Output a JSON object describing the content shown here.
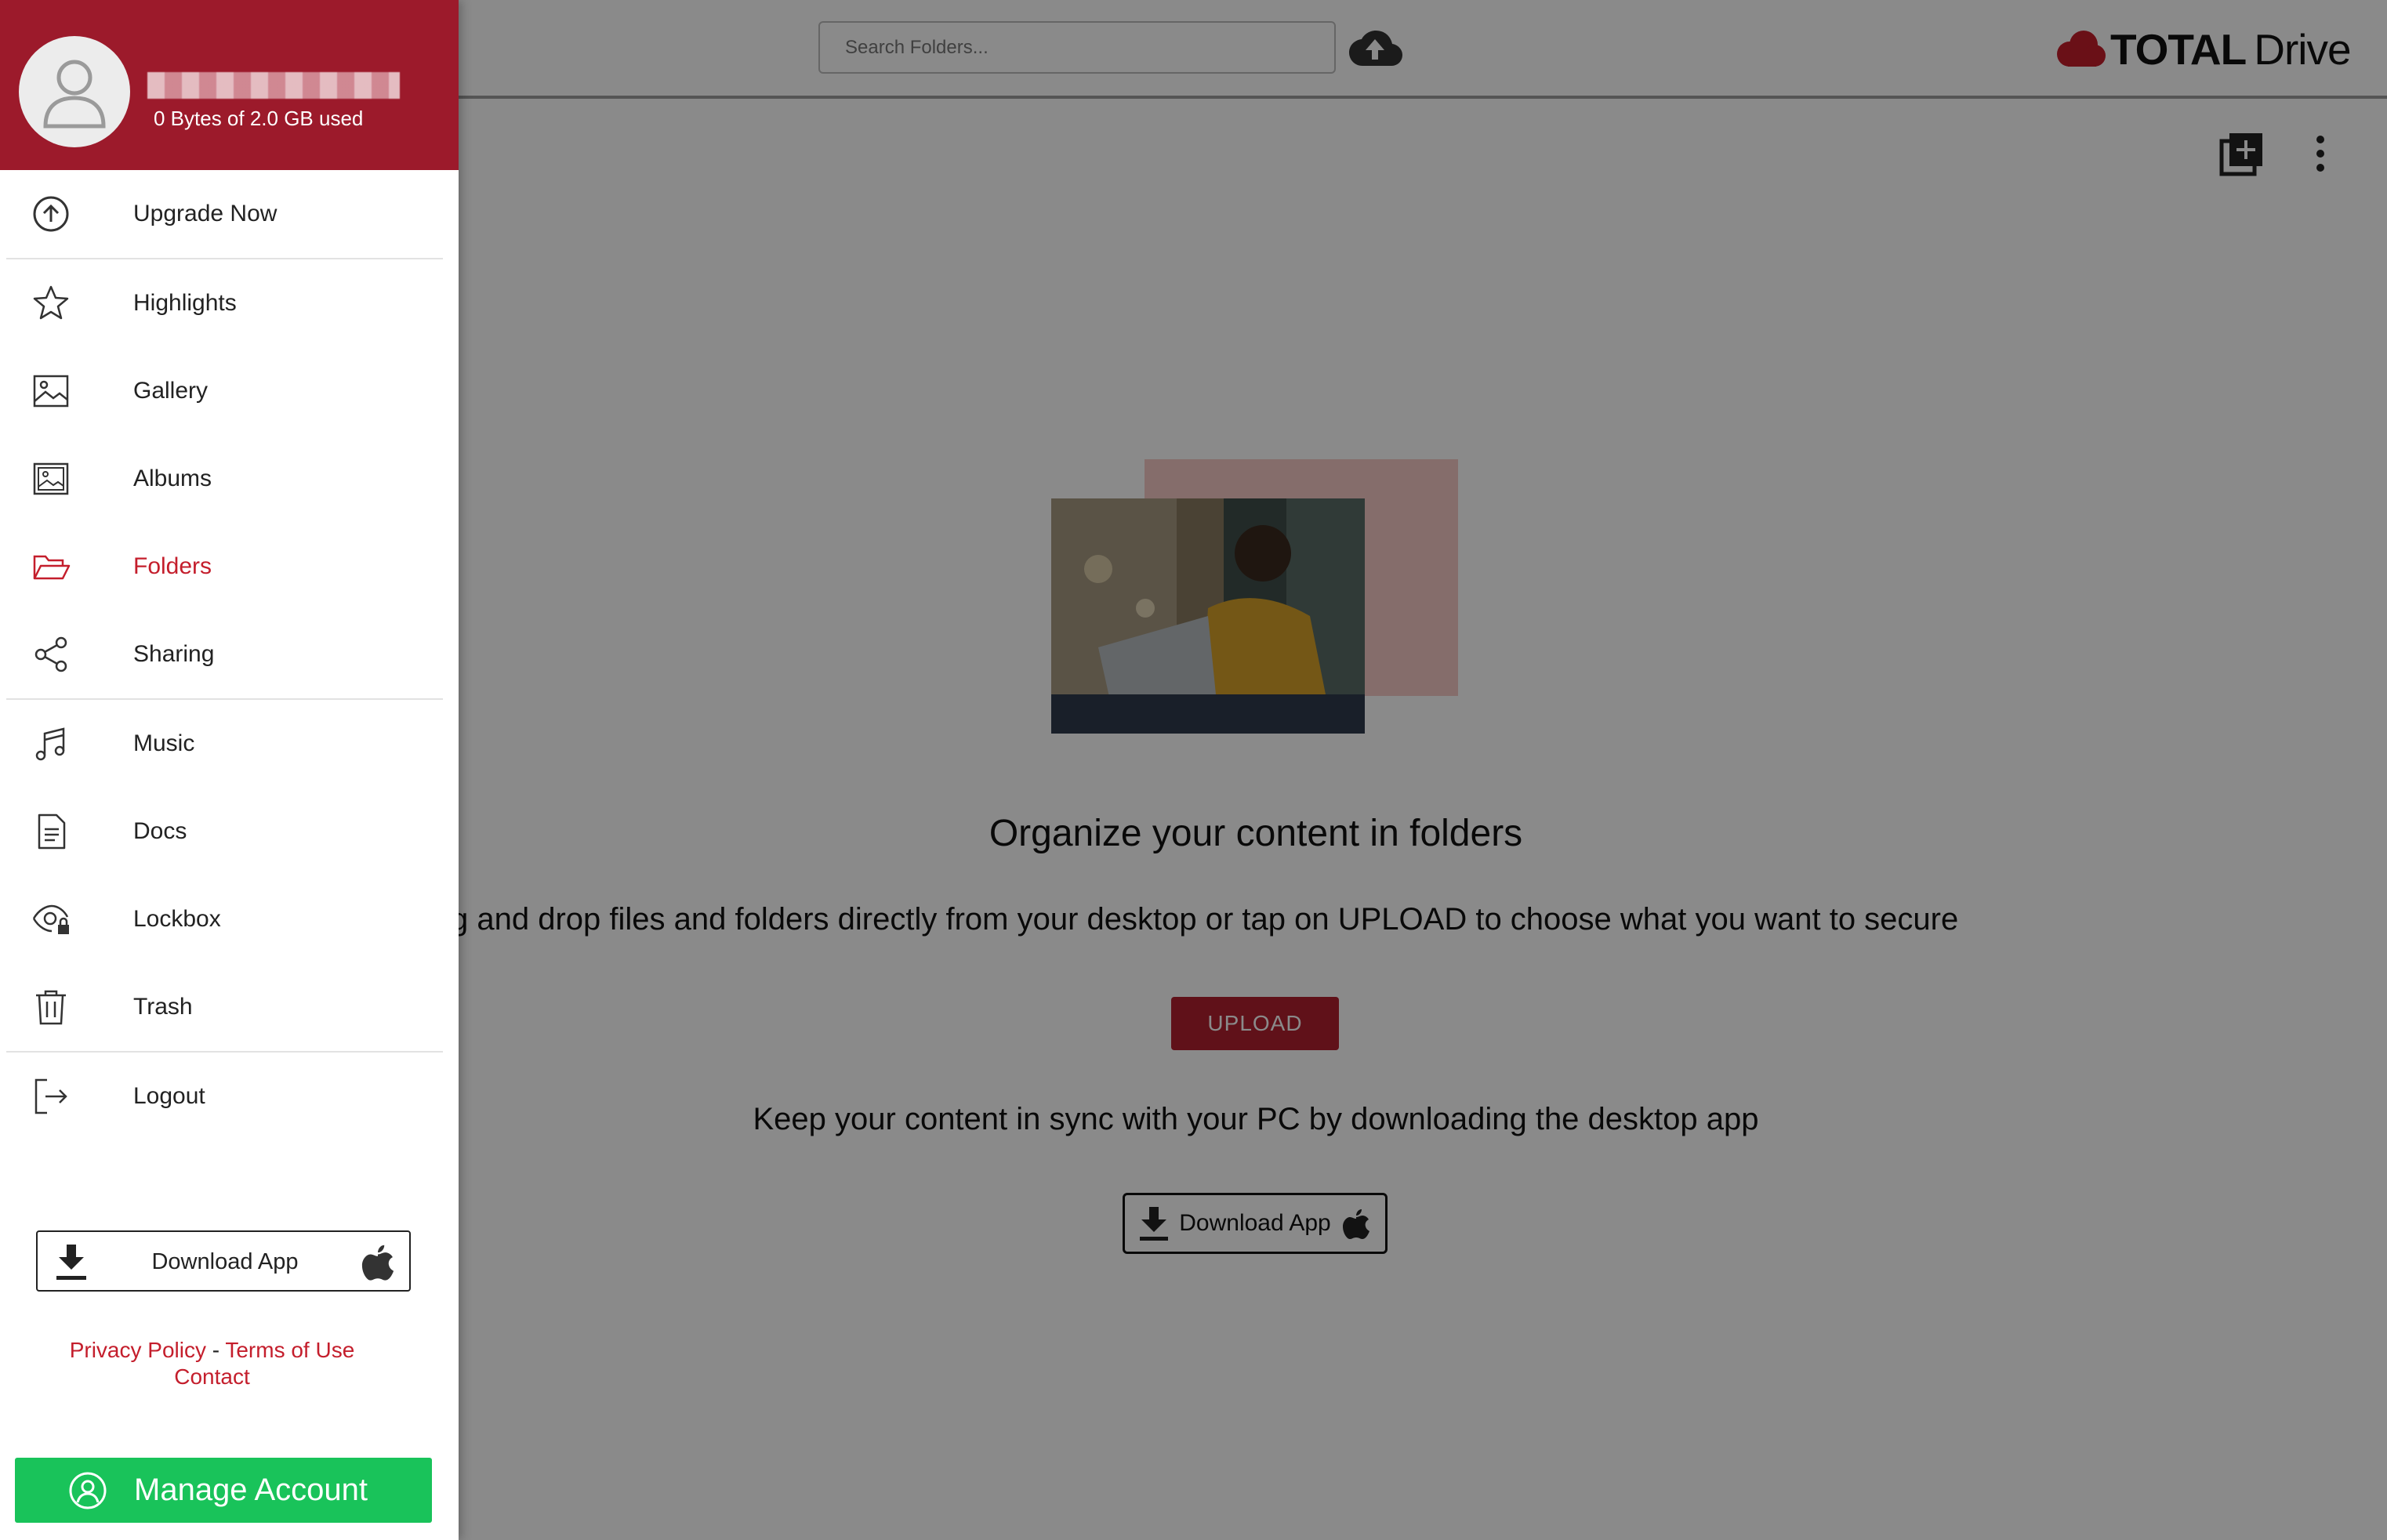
{
  "search": {
    "placeholder": "Search Folders..."
  },
  "brand": {
    "part1": "TOTAL",
    "part2": "Drive"
  },
  "empty_state": {
    "title": "Organize your content in folders",
    "description": "g and drop files and folders directly from your desktop or tap on UPLOAD to choose what you want to secure",
    "upload_label": "UPLOAD",
    "sync_text": "Keep your content in sync with your PC by downloading the desktop app",
    "download_label": "Download App"
  },
  "drawer": {
    "storage": "0 Bytes of 2.0 GB used",
    "items": [
      {
        "label": "Upgrade Now",
        "icon": "upload-circle-icon"
      },
      {
        "label": "Highlights",
        "icon": "star-icon"
      },
      {
        "label": "Gallery",
        "icon": "image-icon"
      },
      {
        "label": "Albums",
        "icon": "albums-icon"
      },
      {
        "label": "Folders",
        "icon": "folder-open-icon",
        "active": true
      },
      {
        "label": "Sharing",
        "icon": "share-icon"
      },
      {
        "label": "Music",
        "icon": "music-icon"
      },
      {
        "label": "Docs",
        "icon": "document-icon"
      },
      {
        "label": "Lockbox",
        "icon": "eye-lock-icon"
      },
      {
        "label": "Trash",
        "icon": "trash-icon"
      },
      {
        "label": "Logout",
        "icon": "logout-icon"
      }
    ],
    "download_label": "Download App",
    "privacy": "Privacy Policy",
    "separator": " - ",
    "terms": "Terms of Use",
    "contact": "Contact",
    "manage_label": "Manage Account"
  },
  "colors": {
    "brand_red": "#9c1a2b",
    "active_red": "#c41e2c",
    "upload_red": "#b1212f",
    "manage_green": "#19c35a"
  }
}
